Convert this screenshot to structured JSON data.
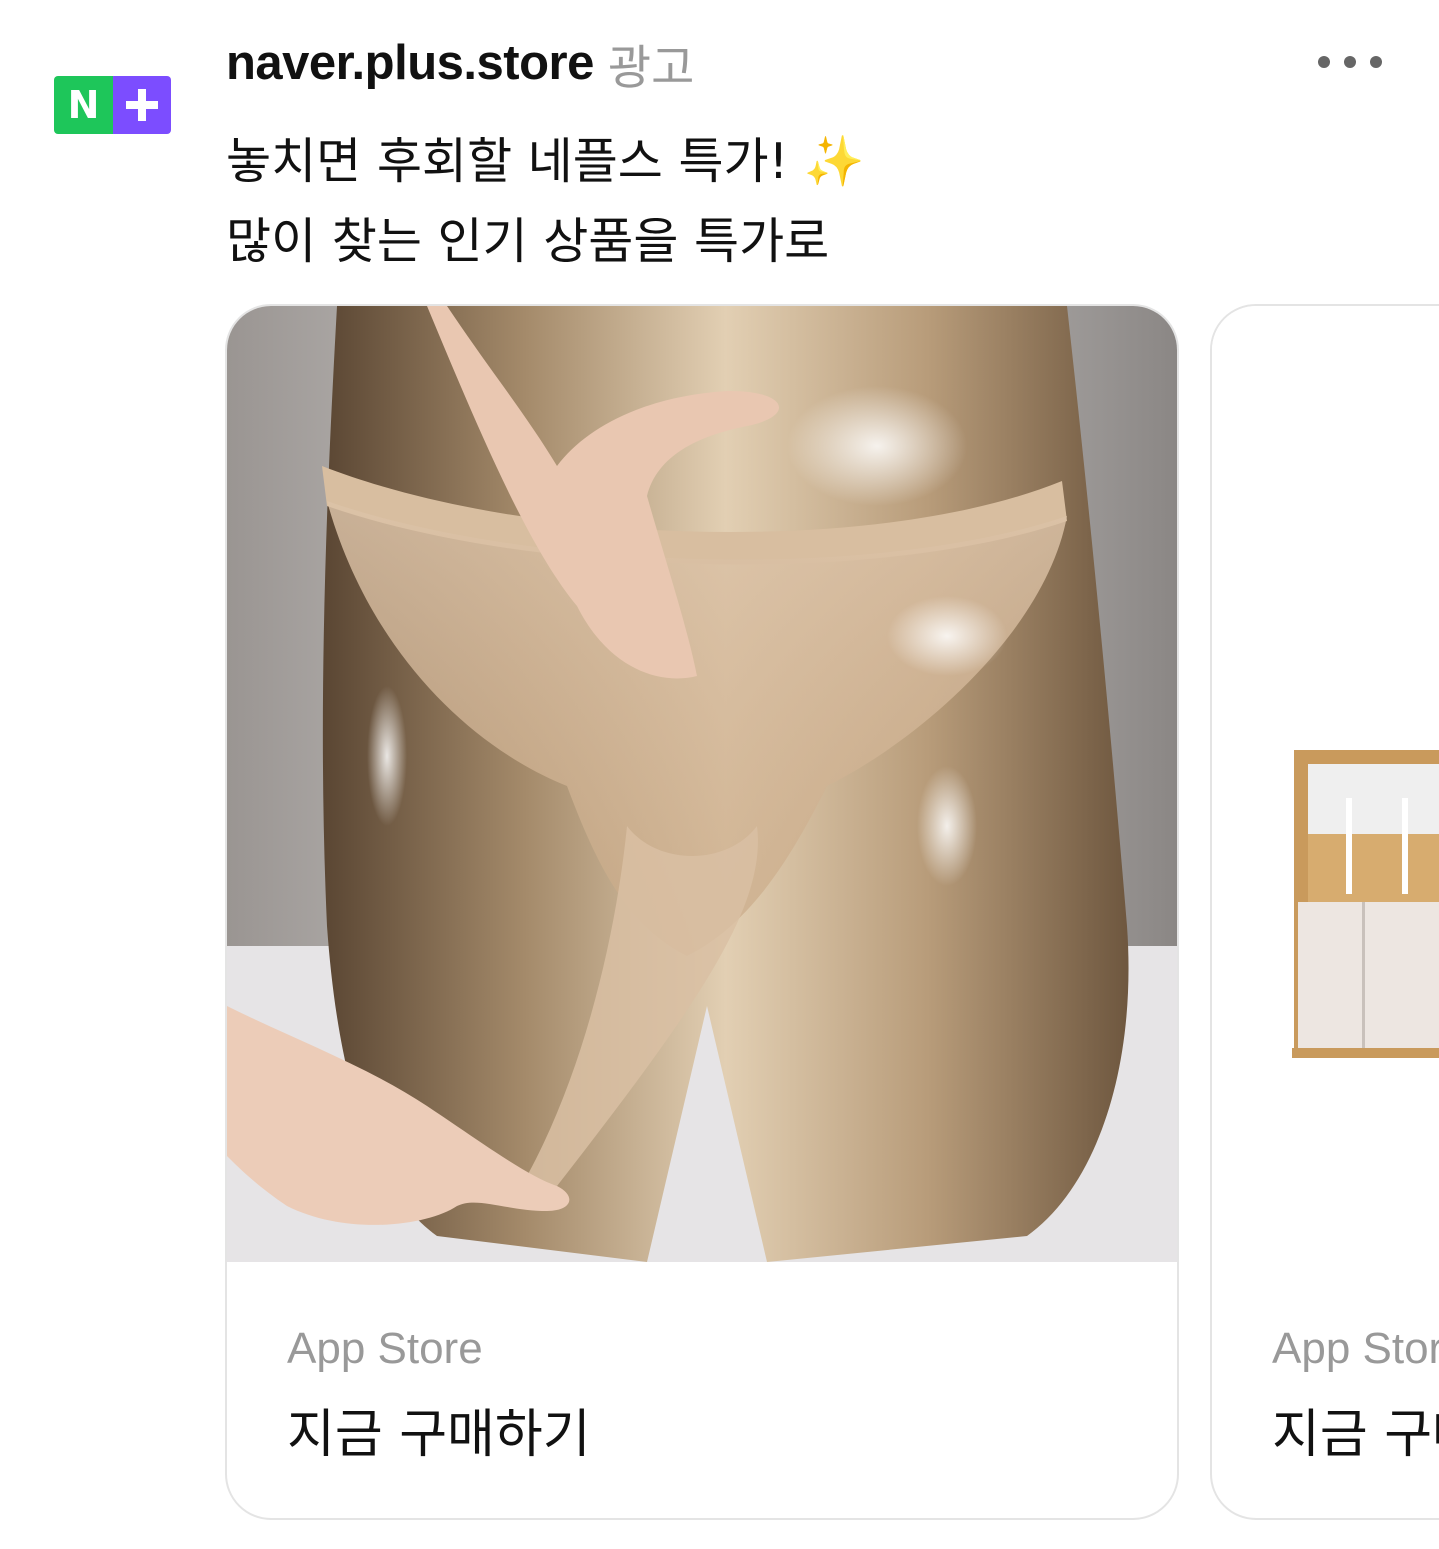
{
  "post": {
    "account_name": "naver.plus.store",
    "ad_label": "광고",
    "body_line1": "놓치면 후회할 네플스 특가! ✨",
    "body_line2": "많이 찾는 인기 상품을 특가로",
    "logo": {
      "letter": "N",
      "green": "#1ec65a",
      "purple": "#7c4dff"
    },
    "more_icon": "more-horizontal-icon"
  },
  "carousel": {
    "cards": [
      {
        "image": "product photo: sheer nude pantyhose on glossy mannequin torso",
        "source": "App Store",
        "cta": "지금 구매하기"
      },
      {
        "image": "product photo: wooden bed frame with white storage drawers",
        "source": "App Store",
        "cta": "지금 구매하기"
      }
    ]
  }
}
